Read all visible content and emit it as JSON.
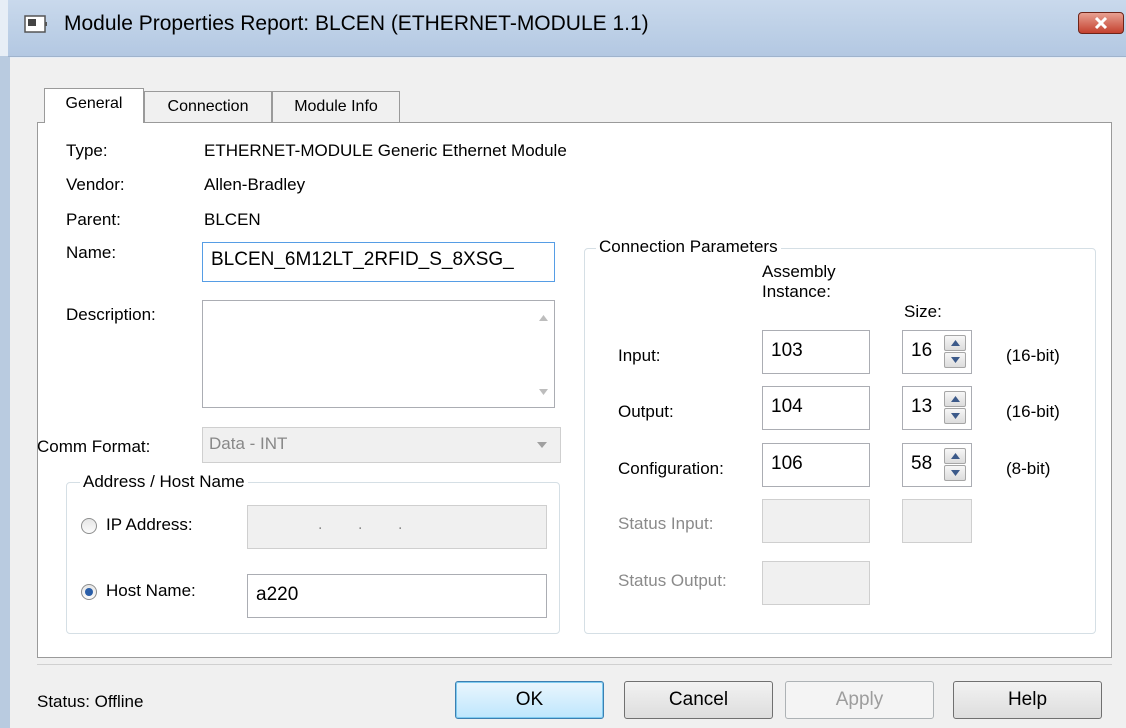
{
  "window": {
    "title": "Module Properties Report: BLCEN (ETHERNET-MODULE 1.1)"
  },
  "tabs": [
    {
      "label": "General",
      "active": true
    },
    {
      "label": "Connection"
    },
    {
      "label": "Module Info"
    }
  ],
  "general": {
    "type_label": "Type:",
    "type_value": "ETHERNET-MODULE Generic Ethernet Module",
    "vendor_label": "Vendor:",
    "vendor_value": "Allen-Bradley",
    "parent_label": "Parent:",
    "parent_value": "BLCEN",
    "name_label": "Name:",
    "name_value": "BLCEN_6M12LT_2RFID_S_8XSG_",
    "description_label": "Description:",
    "description_value": "",
    "comm_format_label": "Comm Format:",
    "comm_format_value": "Data - INT"
  },
  "address": {
    "group_title": "Address / Host Name",
    "ip_label": "IP Address:",
    "ip_value": ".        .        .",
    "host_label": "Host Name:",
    "host_value": "a220",
    "selected": "host"
  },
  "connection_params": {
    "group_title": "Connection Parameters",
    "assembly_header": "Assembly\nInstance:",
    "size_header": "Size:",
    "rows": [
      {
        "label": "Input:",
        "instance": "103",
        "size": "16",
        "unit": "(16-bit)"
      },
      {
        "label": "Output:",
        "instance": "104",
        "size": "13",
        "unit": "(16-bit)"
      },
      {
        "label": "Configuration:",
        "instance": "106",
        "size": "58",
        "unit": "(8-bit)"
      },
      {
        "label": "Status Input:",
        "instance": "",
        "size": "",
        "unit": ""
      },
      {
        "label": "Status Output:",
        "instance": "",
        "size": "",
        "unit": ""
      }
    ]
  },
  "footer": {
    "status_text": "Status:  Offline",
    "ok": "OK",
    "cancel": "Cancel",
    "apply": "Apply",
    "help": "Help"
  },
  "colors": {
    "titlebar": "#b9cce4",
    "close": "#c4412f",
    "default_button": "#bee6fd"
  }
}
